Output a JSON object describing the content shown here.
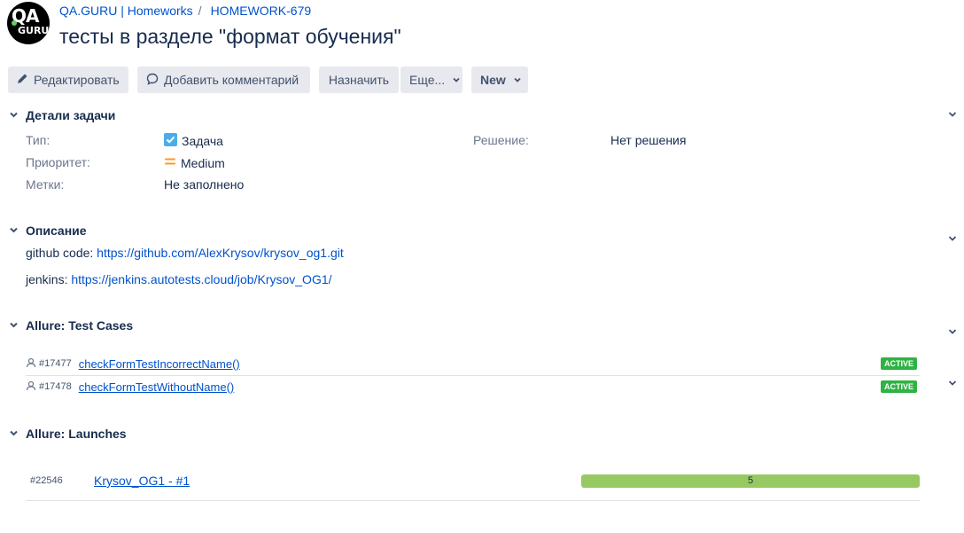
{
  "breadcrumb": {
    "project": "QA.GURU | Homeworks",
    "issue": "HOMEWORK-679",
    "separator": "/"
  },
  "logo": {
    "line1": "QA",
    "line2": "GURU"
  },
  "title": "тесты в разделе \"формат обучения\"",
  "toolbar": {
    "edit": "Редактировать",
    "comment": "Добавить комментарий",
    "assign": "Назначить",
    "more": "Еще...",
    "status": "New"
  },
  "details": {
    "heading": "Детали задачи",
    "type_label": "Тип:",
    "type_value": "Задача",
    "priority_label": "Приоритет:",
    "priority_value": "Medium",
    "labels_label": "Метки:",
    "labels_value": "Не заполнено",
    "resolution_label": "Решение:",
    "resolution_value": "Нет решения"
  },
  "description": {
    "heading": "Описание",
    "line1_prefix": "github code: ",
    "line1_link": "https://github.com/AlexKrysov/krysov_og1.git",
    "line2_prefix": "jenkins: ",
    "line2_link": "https://jenkins.autotests.cloud/job/Krysov_OG1/"
  },
  "test_cases": {
    "heading": "Allure: Test Cases",
    "items": [
      {
        "id": "#17477",
        "name": "checkFormTestIncorrectName()",
        "status": "ACTIVE"
      },
      {
        "id": "#17478",
        "name": "checkFormTestWithoutName()",
        "status": "ACTIVE"
      }
    ]
  },
  "launches": {
    "heading": "Allure: Launches",
    "items": [
      {
        "id": "#22546",
        "name": "Krysov_OG1 - #1",
        "passed": 5,
        "passed_fraction": 1.0
      }
    ]
  },
  "colors": {
    "link": "#0052cc",
    "badge": "#2fb344",
    "bar_passed": "#97c962",
    "priority": "#ff991f",
    "task": "#4bade8"
  },
  "icons": [
    "pencil-icon",
    "comment-icon",
    "chevron-down-icon",
    "task-checkbox-icon",
    "priority-medium-icon",
    "user-icon"
  ]
}
